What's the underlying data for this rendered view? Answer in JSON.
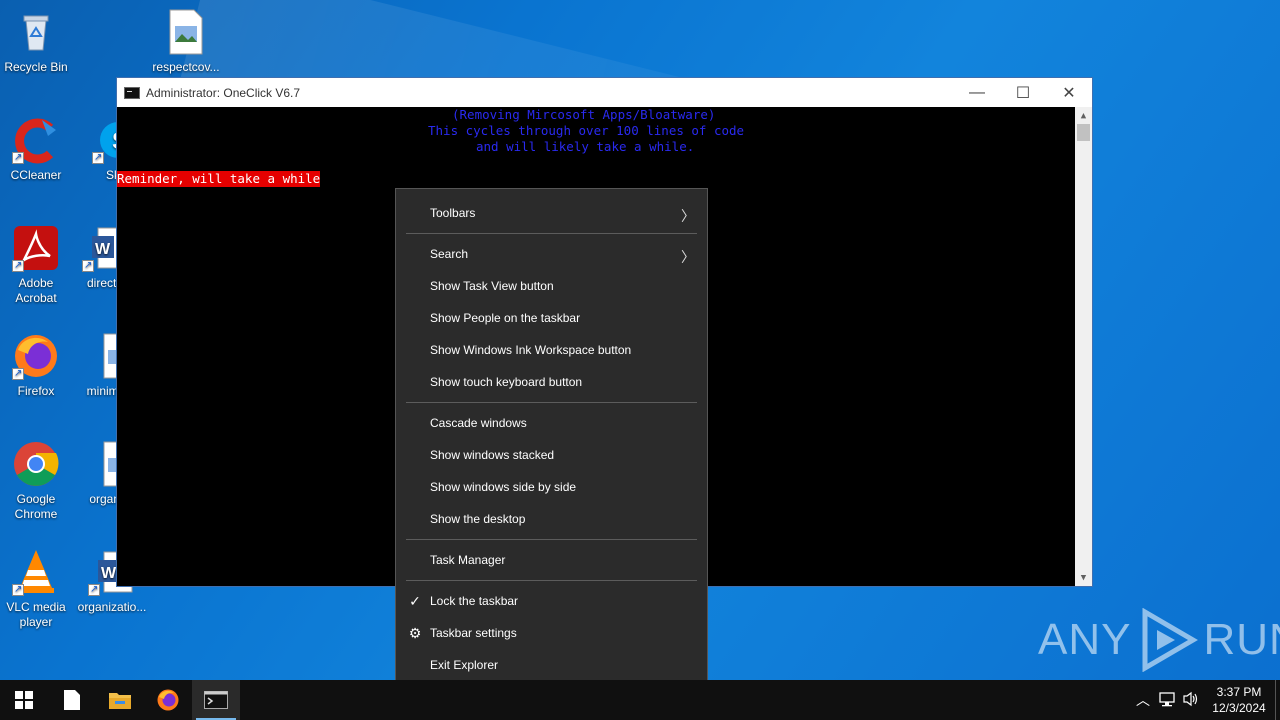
{
  "desktop": {
    "icons_col1": [
      {
        "label": "Recycle Bin",
        "icon": "recycle-bin-icon"
      },
      {
        "label": "CCleaner",
        "icon": "ccleaner-icon"
      },
      {
        "label": "Adobe\nAcrobat",
        "icon": "adobe-acrobat-icon"
      },
      {
        "label": "Firefox",
        "icon": "firefox-icon"
      },
      {
        "label": "Google\nChrome",
        "icon": "chrome-icon"
      },
      {
        "label": "VLC media\nplayer",
        "icon": "vlc-icon"
      }
    ],
    "icons_col2": [
      {
        "label": "respectcov...",
        "icon": "image-file-icon"
      },
      {
        "label": "Sky",
        "icon": "skype-icon"
      },
      {
        "label": "directcl",
        "icon": "word-doc-icon"
      },
      {
        "label": "minimu",
        "icon": "image-file-icon"
      },
      {
        "label": "organi",
        "icon": "image-file-icon"
      },
      {
        "label": "organizatio...",
        "icon": "word-doc-icon"
      }
    ]
  },
  "window": {
    "title": "Administrator:  OneClick V6.7",
    "minimize": "—",
    "maximize": "☐",
    "close": "✕",
    "console_lines": [
      "(Removing Mircosoft Apps/Bloatware)",
      "This cycles through over 100 lines of code",
      "and will likely take a while."
    ],
    "warning": "Reminder, will take a while"
  },
  "context_menu": {
    "items": [
      {
        "label": "Toolbars",
        "submenu": true
      },
      {
        "sep": true
      },
      {
        "label": "Search",
        "submenu": true
      },
      {
        "label": "Show Task View button"
      },
      {
        "label": "Show People on the taskbar"
      },
      {
        "label": "Show Windows Ink Workspace button"
      },
      {
        "label": "Show touch keyboard button"
      },
      {
        "sep": true
      },
      {
        "label": "Cascade windows"
      },
      {
        "label": "Show windows stacked"
      },
      {
        "label": "Show windows side by side"
      },
      {
        "label": "Show the desktop"
      },
      {
        "sep": true
      },
      {
        "label": "Task Manager"
      },
      {
        "sep": true
      },
      {
        "label": "Lock the taskbar",
        "checked": true
      },
      {
        "label": "Taskbar settings",
        "icon": "gear-icon"
      },
      {
        "label": "Exit Explorer"
      }
    ]
  },
  "watermark": {
    "left": "ANY",
    "right": "RUN"
  },
  "taskbar": {
    "apps": [
      "start-icon",
      "notepad-icon",
      "file-explorer-icon",
      "firefox-icon",
      "cmd-icon"
    ],
    "clock_time": "3:37 PM",
    "clock_date": "12/3/2024"
  }
}
